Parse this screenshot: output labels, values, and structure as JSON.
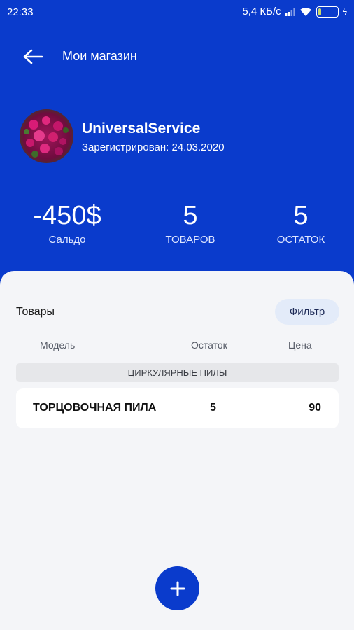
{
  "status_bar": {
    "time": "22:33",
    "network_speed": "5,4 КБ/с",
    "battery": "16"
  },
  "topbar": {
    "title": "Мои магазин"
  },
  "profile": {
    "name": "UniversalService",
    "registered": "Зарегистрирован: 24.03.2020"
  },
  "stats": [
    {
      "value": "-450$",
      "label": "Сальдо"
    },
    {
      "value": "5",
      "label": "ТОВАРОВ"
    },
    {
      "value": "5",
      "label": "ОСТАТОК"
    }
  ],
  "products_section": {
    "title": "Товары",
    "filter_label": "Фильтр",
    "columns": [
      "Модель",
      "Остаток",
      "Цена"
    ],
    "category": "ЦИРКУЛЯРНЫЕ ПИЛЫ",
    "rows": [
      {
        "model": "ТОРЦОВОЧНАЯ ПИЛА",
        "stock": "5",
        "price": "90"
      }
    ]
  },
  "fab": {
    "label": "+"
  },
  "colors": {
    "brand_blue": "#0a3bcc",
    "background": "#f4f5f8",
    "filter_bg": "#e3ebf9"
  }
}
